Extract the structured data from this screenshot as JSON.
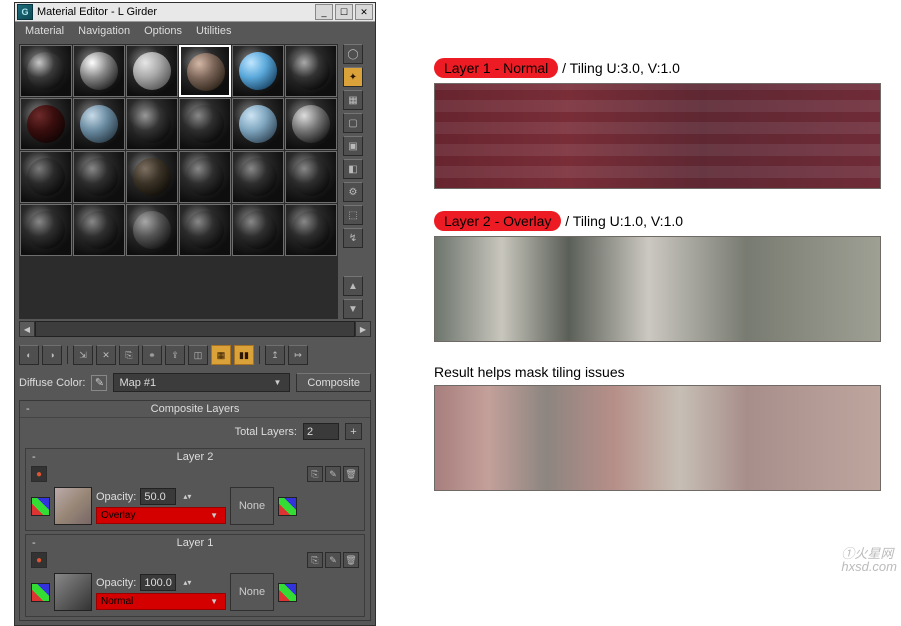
{
  "title": "Material Editor - L Girder",
  "menu": {
    "m1": "Material",
    "m2": "Navigation",
    "m3": "Options",
    "m4": "Utilities"
  },
  "diffuse": {
    "label": "Diffuse Color:",
    "map": "Map #1",
    "type": "Composite"
  },
  "comp": {
    "title": "Composite Layers",
    "total_label": "Total Layers:",
    "total_val": "2"
  },
  "l2": {
    "title": "Layer 2",
    "opacity_label": "Opacity:",
    "opacity_val": "50.0",
    "blend": "Overlay",
    "none": "None"
  },
  "l1": {
    "title": "Layer 1",
    "opacity_label": "Opacity:",
    "opacity_val": "100.0",
    "blend": "Normal",
    "none": "None"
  },
  "r": {
    "tag1": "Layer 1 - Normal",
    "suf1": " / Tiling U:3.0, V:1.0",
    "tag2": "Layer 2 - Overlay",
    "suf2": " / Tiling U:1.0, V:1.0",
    "res": "Result helps mask tiling issues"
  },
  "wm": {
    "a": "①火星网",
    "b": "hxsd.com"
  }
}
